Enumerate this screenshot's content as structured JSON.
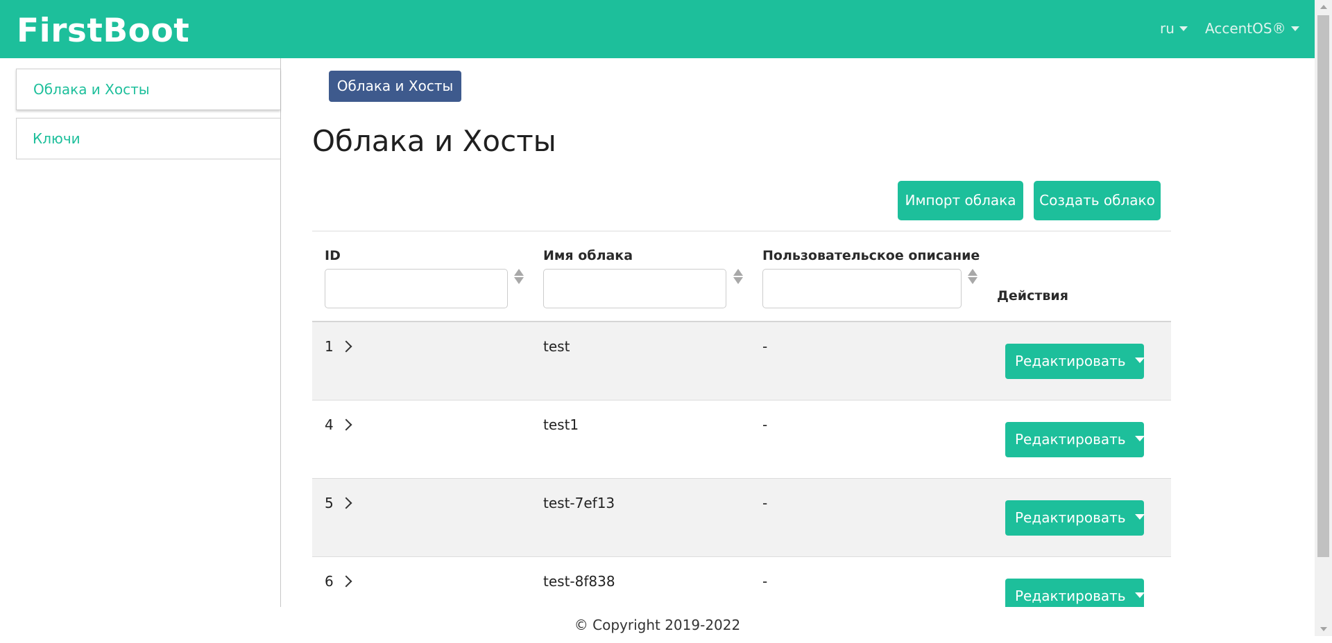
{
  "header": {
    "brand": "FirstBoot",
    "language": "ru",
    "user": "AccentOS®"
  },
  "sidebar": {
    "items": [
      {
        "label": "Облака и Хосты",
        "active": true
      },
      {
        "label": "Ключи",
        "active": false
      }
    ]
  },
  "breadcrumb": {
    "label": "Облака и Хосты"
  },
  "page": {
    "title": "Облака и Хосты"
  },
  "toolbar": {
    "import_label": "Импорт облака",
    "create_label": "Создать облако"
  },
  "table": {
    "columns": {
      "id": "ID",
      "name": "Имя облака",
      "description": "Пользовательское описание",
      "actions": "Действия"
    },
    "filters": {
      "id": "",
      "name": "",
      "description": ""
    },
    "rows": [
      {
        "id": "1",
        "name": "test",
        "description": "-",
        "action": "Редактировать"
      },
      {
        "id": "4",
        "name": "test1",
        "description": "-",
        "action": "Редактировать"
      },
      {
        "id": "5",
        "name": "test-7ef13",
        "description": "-",
        "action": "Редактировать"
      },
      {
        "id": "6",
        "name": "test-8f838",
        "description": "-",
        "action": "Редактировать"
      }
    ]
  },
  "footer": {
    "copyright": "© Copyright 2019-2022"
  },
  "colors": {
    "accent": "#1dbf9b",
    "breadcrumb": "#3e5a8d",
    "row_stripe": "#f2f2f2"
  },
  "icons": [
    "caret-down-icon",
    "sort-icon",
    "chevron-right-icon"
  ]
}
